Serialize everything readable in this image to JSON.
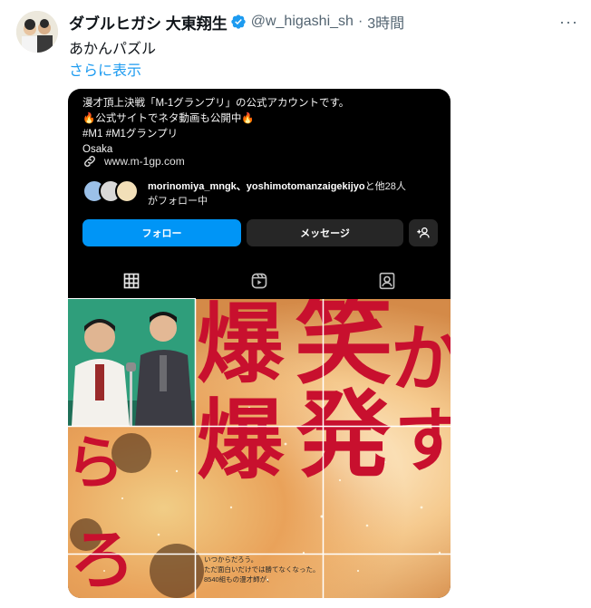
{
  "tweet": {
    "author_name": "ダブルヒガシ 大東翔生",
    "handle": "@w_higashi_sh",
    "dot": "·",
    "time": "3時間",
    "more_icon": "more-icon",
    "text": "あかんパズル",
    "show_more": "さらに表示"
  },
  "profile_screenshot": {
    "bio_lines": [
      "漫才頂上決戦「M-1グランプリ」の公式アカウントです。",
      "🔥公式サイトでネタ動画も公開中🔥",
      "#M1 #M1グランプリ",
      "Osaka"
    ],
    "link": "www.m-1gp.com",
    "followers_names": "morinomiya_mngk、yoshimotomanzaigekijyo",
    "followers_suffix": "と他28人",
    "followers_line2": "がフォロー中",
    "follow_button": "フォロー",
    "message_button": "メッセージ",
    "tabs": [
      "grid-icon",
      "reels-icon",
      "tagged-icon"
    ]
  },
  "grid": {
    "poster_chars": [
      "爆",
      "笑",
      "爆",
      "発",
      "か",
      "す",
      "ら",
      "ろ"
    ],
    "poster_small_lines": [
      "いつからだろう。",
      "ただ面白いだけでは勝てなくなった。",
      "8540組もの漫才師が、"
    ]
  },
  "colors": {
    "accent": "#1d9bf0",
    "verified": "#1d9bf0",
    "follow_button": "#0095f6",
    "poster_red": "#c8102e"
  }
}
